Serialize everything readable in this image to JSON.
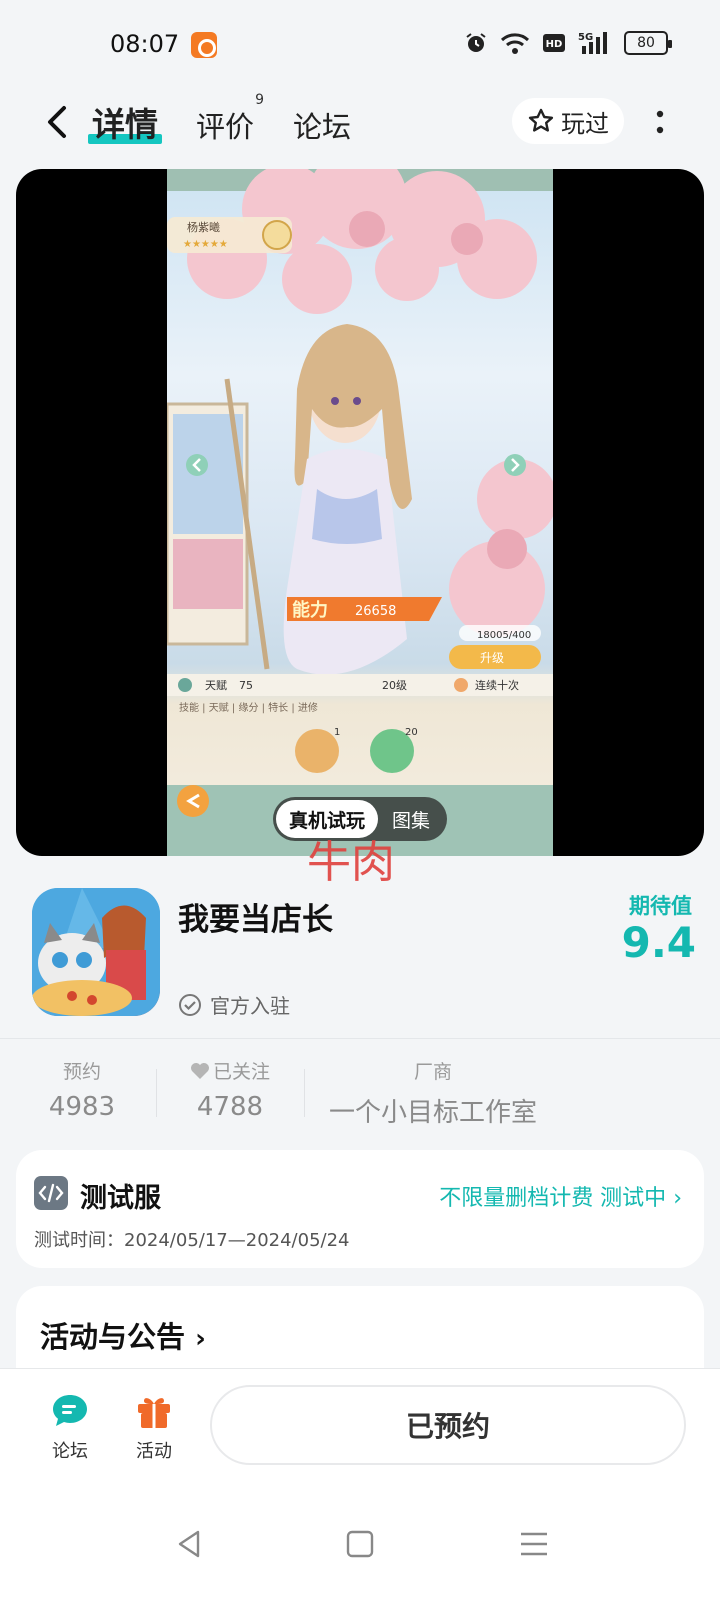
{
  "status_bar": {
    "time": "08:07",
    "battery": "80"
  },
  "nav": {
    "tabs": [
      {
        "label": "详情",
        "active": true
      },
      {
        "label": "评价",
        "badge": "9"
      },
      {
        "label": "论坛"
      }
    ],
    "played_label": "玩过"
  },
  "media": {
    "toggle": {
      "active": "真机试玩",
      "inactive": "图集"
    },
    "screenshot": {
      "character_name": "杨紫曦",
      "power_label": "能力",
      "power_value": "26658",
      "progress": "18005/400",
      "upgrade": "升级",
      "talent": "天赋",
      "talent_value": "75",
      "level": "20级",
      "continuous": "连续十次",
      "skill_tabs": "技能 | 天赋 | 缘分 | 特长 | 进修",
      "badge_1": "1",
      "badge_2": "20"
    },
    "watermark": "牛肉"
  },
  "app": {
    "title": "我要当店长",
    "official": "官方入驻",
    "expect_label": "期待值",
    "expect_value": "9.4"
  },
  "stats": [
    {
      "label": "预约",
      "value": "4983"
    },
    {
      "label": "已关注",
      "value": "4788"
    },
    {
      "label": "厂商",
      "value": "一个小目标工作室"
    }
  ],
  "test_server": {
    "title": "测试服",
    "status": "不限量删档计费 测试中",
    "time": "测试时间：2024/05/17—2024/05/24"
  },
  "activity": {
    "title": "活动与公告"
  },
  "bottom_bar": {
    "forum_label": "论坛",
    "activity_label": "活动",
    "reserved_label": "已预约"
  },
  "colors": {
    "accent": "#14c6c0",
    "activity_icon": "#f06a2a",
    "watermark": "#e0413d"
  }
}
